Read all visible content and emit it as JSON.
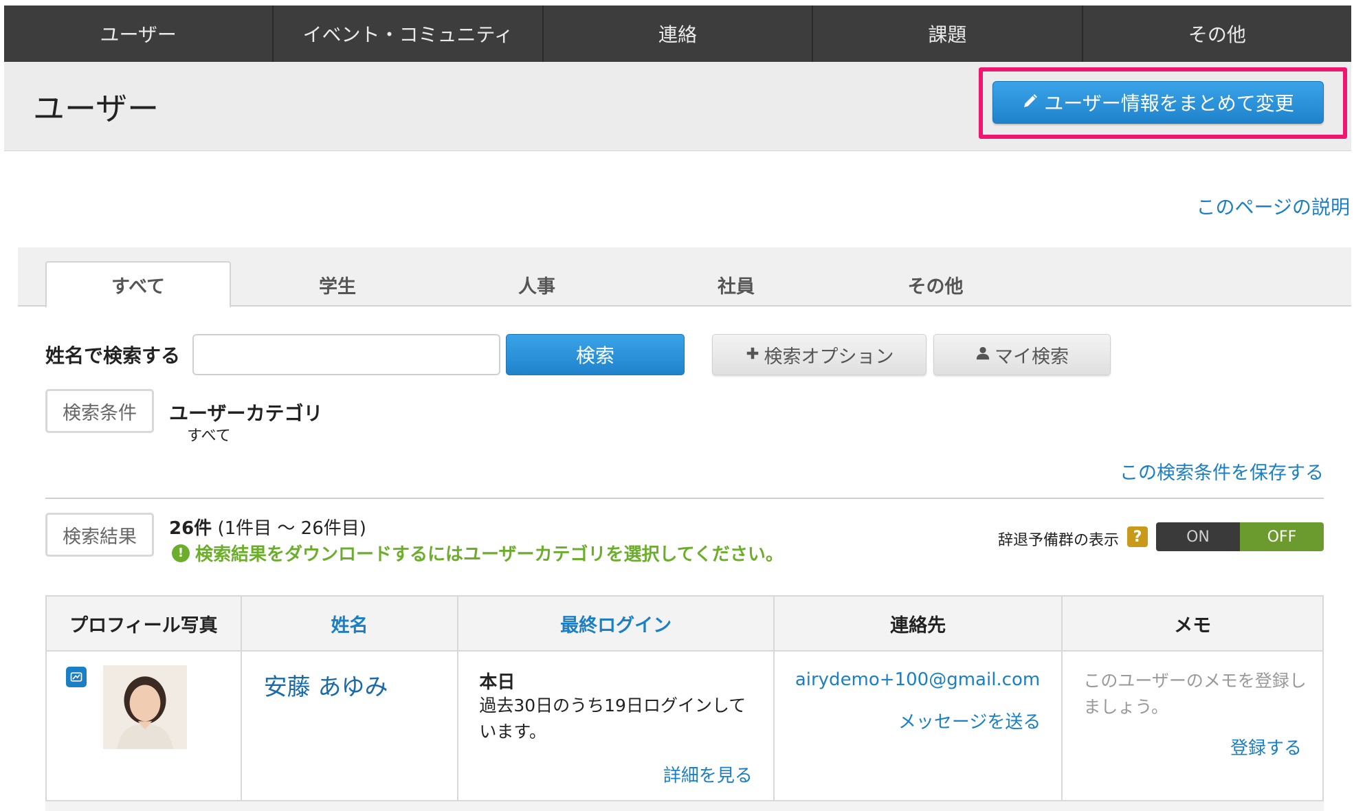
{
  "topnav": {
    "items": [
      "ユーザー",
      "イベント・コミュニティ",
      "連絡",
      "課題",
      "その他"
    ]
  },
  "header": {
    "title": "ユーザー",
    "bulk_edit_label": "ユーザー情報をまとめて変更"
  },
  "help_link": "このページの説明",
  "tabs": [
    "すべて",
    "学生",
    "人事",
    "社員",
    "その他"
  ],
  "search": {
    "label": "姓名で検索する",
    "value": "",
    "button": "検索",
    "options_button": "検索オプション",
    "my_search_button": "マイ検索"
  },
  "conditions": {
    "box_label": "検索条件",
    "title": "ユーザーカテゴリ",
    "value": "すべて",
    "save_link": "この検索条件を保存する"
  },
  "results": {
    "box_label": "検索結果",
    "count_bold": "26件",
    "count_range": " (1件目 〜 26件目)",
    "warning": "検索結果をダウンロードするにはユーザーカテゴリを選択してください。",
    "toggle_label": "辞退予備群の表示",
    "help_badge": "?",
    "toggle_on": "ON",
    "toggle_off": "OFF"
  },
  "table": {
    "headers": [
      "プロフィール写真",
      "姓名",
      "最終ログイン",
      "連絡先",
      "メモ"
    ],
    "rows": [
      {
        "name": "安藤 あゆみ",
        "last_login": "本日",
        "login_desc": "過去30日のうち19日ログインしています。",
        "detail_link": "詳細を見る",
        "email": "airydemo+100@gmail.com",
        "message_link": "メッセージを送る",
        "memo_placeholder": "このユーザーのメモを登録しましょう。",
        "register_link": "登録する"
      }
    ]
  },
  "colors": {
    "nav_bg": "#3d3d3d",
    "primary_blue": "#1f83cc",
    "link_blue": "#1a7fc4",
    "highlight": "#f0156e",
    "success_green": "#6cae2c"
  }
}
